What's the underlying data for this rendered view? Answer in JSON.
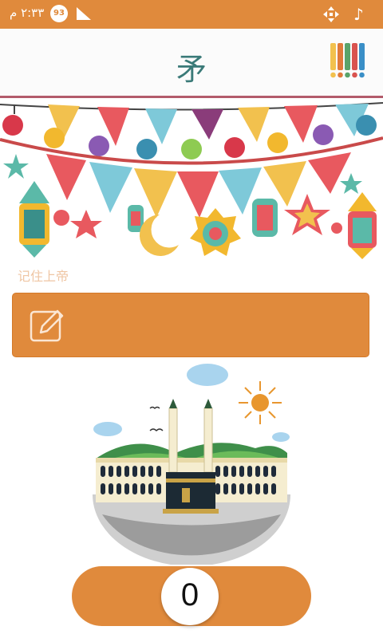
{
  "status_bar": {
    "time": "٢:٣٣ م",
    "battery_percent": "93",
    "icons": [
      "signal-icon",
      "drag-move-icon",
      "music-note-icon"
    ],
    "color": "#e08a3c"
  },
  "app_bar": {
    "title": "矛",
    "title_color": "#3a7a78",
    "palette_colors": [
      "#f2c14e",
      "#e07a3a",
      "#5aa36a",
      "#d9534f",
      "#3a8fc7"
    ]
  },
  "banner": {
    "description_icon": "ramadan-festive-banner"
  },
  "dhikr": {
    "hint": "记住上帝",
    "input_value": "",
    "edit_icon": "edit-pencil-icon"
  },
  "illustration": {
    "icon": "kaaba-mosque-illustration"
  },
  "counter": {
    "value": "0"
  },
  "colors": {
    "accent": "#e08a3c",
    "divider": "#b35b6b"
  }
}
